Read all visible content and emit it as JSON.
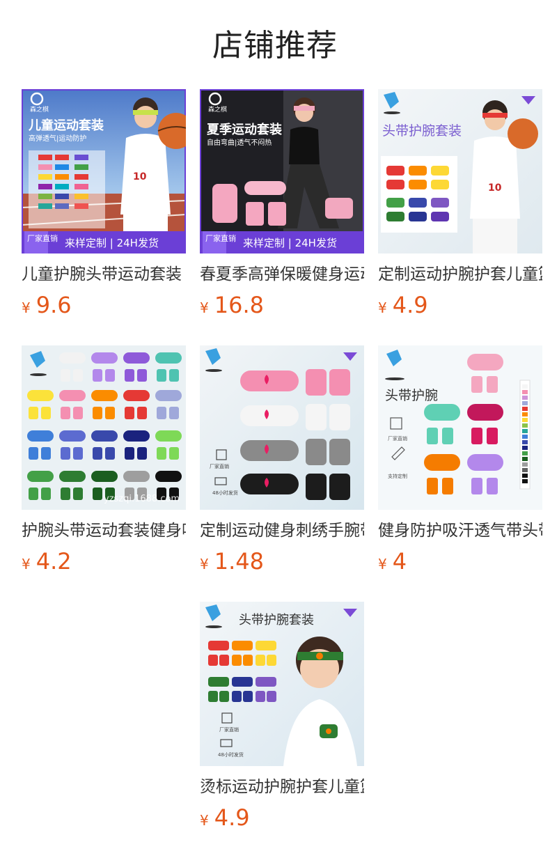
{
  "section_title": "店铺推荐",
  "currency": "¥",
  "products": [
    {
      "name": "儿童护腕头带运动套装",
      "price": "9.6",
      "image": {
        "brand": "森之棋",
        "headline": "儿童运动套装",
        "subline": "高弹透气|运动防护",
        "banner_badge": "厂家直销",
        "banner_text": "来样定制 | 24H发货",
        "jersey_number": "10"
      }
    },
    {
      "name": "春夏季高弹保暖健身运动护膝",
      "price": "16.8",
      "image": {
        "brand": "森之棋",
        "headline": "夏季运动套装",
        "subline": "自由弯曲|透气不闷热",
        "banner_badge": "厂家直销",
        "banner_text": "来样定制 | 24H发货"
      }
    },
    {
      "name": "定制运动护腕护套儿童篮球",
      "price": "4.9",
      "image": {
        "headline": "头带护腕套装",
        "jersey_number": "10"
      }
    },
    {
      "name": "护腕头带运动套装健身吸汗",
      "price": "4.2",
      "image": {
        "watermark": "yzszqi.1688.com"
      }
    },
    {
      "name": "定制运动健身刺绣手腕带",
      "price": "1.48",
      "image": {
        "feature_1": "厂家直销",
        "feature_2": "48小时发货"
      }
    },
    {
      "name": "健身防护吸汗透气带头带",
      "price": "4",
      "image": {
        "headline": "头带护腕",
        "feature_1": "厂家直销",
        "feature_2": "支持定制"
      }
    },
    {
      "name": "烫标运动护腕护套儿童篮球",
      "price": "4.9",
      "image": {
        "headline": "头带护腕套装",
        "feature_1": "厂家直销",
        "feature_2": "48小时发货"
      }
    }
  ],
  "colors": {
    "price": "#e4571a",
    "banner_purple": "#6b3fd6",
    "title": "#222222"
  }
}
